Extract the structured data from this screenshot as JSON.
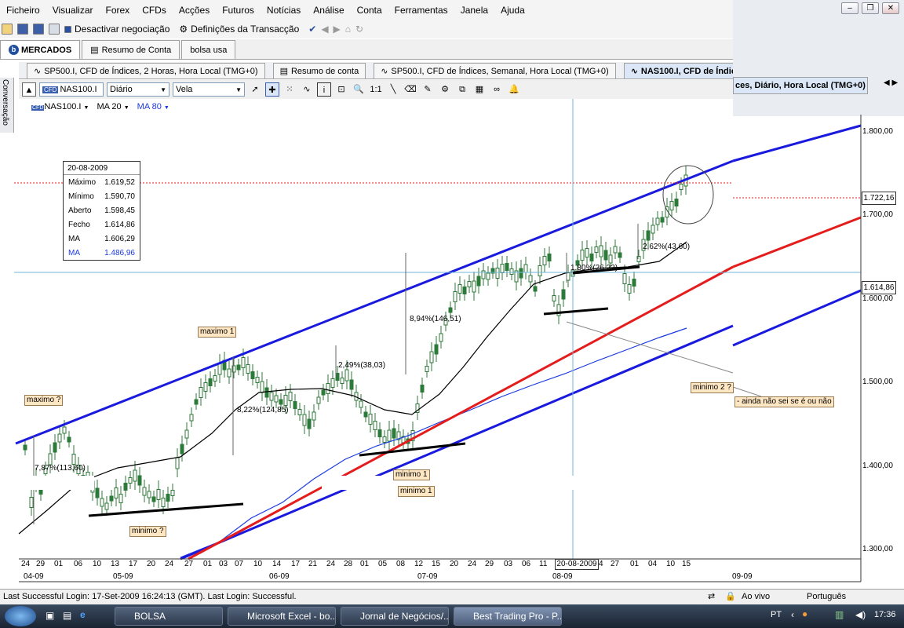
{
  "menu": [
    "Ficheiro",
    "Visualizar",
    "Forex",
    "CFDs",
    "Acções",
    "Futuros",
    "Notícias",
    "Análise",
    "Conta",
    "Ferramentas",
    "Janela",
    "Ajuda"
  ],
  "toolbar": {
    "deactivate": "Desactivar negociação",
    "settings": "Definições da Transacção"
  },
  "top_tabs": [
    "MERCADOS",
    "Resumo de Conta",
    "bolsa usa"
  ],
  "chart_tabs": [
    "SP500.I, CFD de Índices, 2 Horas, Hora Local (TMG+0)",
    "Resumo de conta",
    "SP500.I, CFD de Índices, Semanal, Hora Local (TMG+0)",
    "NAS100.I, CFD de Índic"
  ],
  "chart_tab_overflow": "ces, Diário, Hora Local (TMG+0)",
  "side_label": "Conversação",
  "chart_toolbar": {
    "symbol": "NAS100.I",
    "period": "Diário",
    "type": "Vela"
  },
  "indicators": [
    "NAS100.I",
    "MA 20",
    "MA 80"
  ],
  "infobox": {
    "date": "20-08-2009",
    "rows": [
      {
        "label": "Máximo",
        "value": "1.619,52"
      },
      {
        "label": "Mínimo",
        "value": "1.590,70"
      },
      {
        "label": "Aberto",
        "value": "1.598,45"
      },
      {
        "label": "Fecho",
        "value": "1.614,86"
      },
      {
        "label": "MA",
        "value": "1.606,29"
      },
      {
        "label": "MA",
        "value": "1.486,96"
      }
    ]
  },
  "annotations": {
    "max1": "maximo 1",
    "max_q": "maximo ?",
    "min1": "minimo 1",
    "min1b": "minimo 1",
    "min_q": "minimo ?",
    "min2": "minimo 2 ?",
    "note": "- ainda não sei se é ou não"
  },
  "pct_labels": [
    "8,94%(146,51)",
    "2,49%(38,03)",
    "8,22%(124,85)",
    "7,87%(113,60)",
    "1,80%(26,22)",
    "2,62%(43,60)"
  ],
  "price_axis": [
    "1.800,00",
    "1.700,00",
    "1.600,00",
    "1.500,00",
    "1.400,00",
    "1.300,00"
  ],
  "price_boxes": {
    "last": "1.722,16",
    "cursor": "1.614,86"
  },
  "date_ticks": [
    "24",
    "29",
    "01",
    "06",
    "10",
    "13",
    "17",
    "20",
    "24",
    "27",
    "01",
    "03",
    "07",
    "10",
    "14",
    "17",
    "21",
    "24",
    "28",
    "01",
    "05",
    "08",
    "12",
    "15",
    "20",
    "24",
    "29",
    "03",
    "06",
    "11",
    "4",
    "27",
    "01",
    "04",
    "10",
    "15"
  ],
  "cursor_date": "20-08-2009",
  "months": [
    "04-09",
    "05-09",
    "06-09",
    "07-09",
    "08-09",
    "09-09"
  ],
  "status": {
    "login": "Last Successful Login: 17-Set-2009 16:24:13 (GMT). Last Login: Successful.",
    "live": "Ao vivo",
    "lang": "Português"
  },
  "taskbar": {
    "tasks": [
      "BOLSA",
      "Microsoft Excel - bo...",
      "Jornal de Negócios/...",
      "Best Trading Pro - P..."
    ],
    "lang": "PT",
    "time": "17:36"
  },
  "colors": {
    "channel": "#1a1adf",
    "support": "#e51c1c",
    "ma20": "#000000",
    "ma80": "#1a3ae0"
  }
}
